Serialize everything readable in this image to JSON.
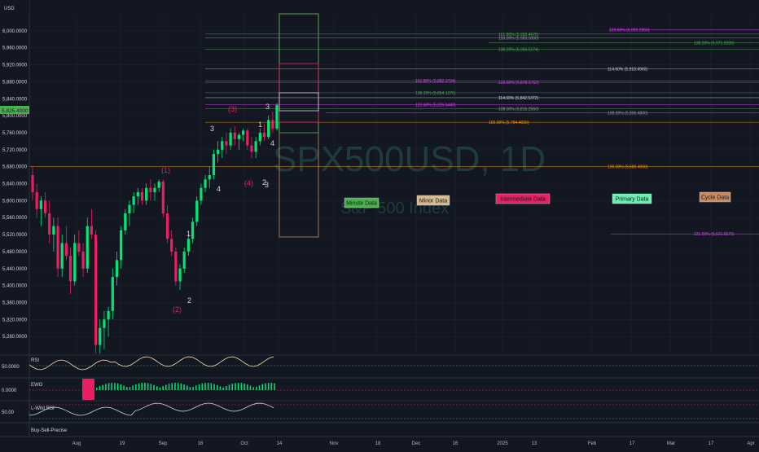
{
  "header": {
    "currency": "USD",
    "current_price": "5,825.4000"
  },
  "watermark": {
    "symbol": "SPX500USD, 1D",
    "name": "S&P 500 Index"
  },
  "price_axis": {
    "min": 5240,
    "max": 6040,
    "labels": [
      "6,000.0000",
      "5,960.0000",
      "5,920.0000",
      "5,880.0000",
      "5,840.0000",
      "5,800.0000",
      "5,760.0000",
      "5,720.0000",
      "5,680.0000",
      "5,640.0000",
      "5,600.0000",
      "5,560.0000",
      "5,520.0000",
      "5,480.0000",
      "5,440.0000",
      "5,400.0000",
      "5,360.0000",
      "5,320.0000",
      "5,280.0000"
    ],
    "values": [
      6000,
      5960,
      5920,
      5880,
      5840,
      5800,
      5760,
      5720,
      5680,
      5640,
      5600,
      5560,
      5520,
      5480,
      5440,
      5400,
      5360,
      5320,
      5280
    ]
  },
  "time_axis": {
    "labels": [
      "Aug",
      "19",
      "Sep",
      "16",
      "Oct",
      "14",
      "Nov",
      "18",
      "Dec",
      "16",
      "2025",
      "13",
      "Feb",
      "17",
      "Mar",
      "17",
      "Apr"
    ]
  },
  "chart_data": {
    "type": "candlestick",
    "title": "SPX500USD, 1D",
    "ylim": [
      5240,
      6040
    ],
    "bars": [
      [
        5660,
        5680,
        5600,
        5620
      ],
      [
        5620,
        5640,
        5560,
        5580
      ],
      [
        5580,
        5610,
        5540,
        5600
      ],
      [
        5600,
        5620,
        5560,
        5570
      ],
      [
        5570,
        5600,
        5500,
        5520
      ],
      [
        5520,
        5560,
        5480,
        5540
      ],
      [
        5540,
        5560,
        5420,
        5440
      ],
      [
        5440,
        5520,
        5420,
        5500
      ],
      [
        5500,
        5540,
        5460,
        5470
      ],
      [
        5470,
        5490,
        5380,
        5410
      ],
      [
        5410,
        5520,
        5400,
        5500
      ],
      [
        5500,
        5530,
        5470,
        5480
      ],
      [
        5480,
        5500,
        5420,
        5440
      ],
      [
        5440,
        5560,
        5430,
        5540
      ],
      [
        5540,
        5580,
        5510,
        5520
      ],
      [
        5520,
        5530,
        5240,
        5260
      ],
      [
        5260,
        5320,
        5200,
        5300
      ],
      [
        5300,
        5340,
        5250,
        5320
      ],
      [
        5320,
        5350,
        5280,
        5340
      ],
      [
        5340,
        5440,
        5320,
        5420
      ],
      [
        5420,
        5480,
        5400,
        5460
      ],
      [
        5460,
        5540,
        5440,
        5530
      ],
      [
        5530,
        5580,
        5520,
        5570
      ],
      [
        5570,
        5600,
        5540,
        5590
      ],
      [
        5590,
        5620,
        5570,
        5610
      ],
      [
        5610,
        5630,
        5590,
        5620
      ],
      [
        5620,
        5630,
        5590,
        5600
      ],
      [
        5600,
        5640,
        5590,
        5630
      ],
      [
        5630,
        5650,
        5600,
        5620
      ],
      [
        5620,
        5640,
        5600,
        5630
      ],
      [
        5630,
        5650,
        5620,
        5645
      ],
      [
        5645,
        5650,
        5560,
        5570
      ],
      [
        5570,
        5590,
        5500,
        5510
      ],
      [
        5510,
        5530,
        5470,
        5480
      ],
      [
        5480,
        5490,
        5400,
        5410
      ],
      [
        5410,
        5450,
        5390,
        5440
      ],
      [
        5440,
        5490,
        5430,
        5480
      ],
      [
        5480,
        5520,
        5470,
        5510
      ],
      [
        5510,
        5560,
        5500,
        5550
      ],
      [
        5550,
        5610,
        5540,
        5600
      ],
      [
        5600,
        5640,
        5590,
        5630
      ],
      [
        5630,
        5660,
        5620,
        5650
      ],
      [
        5650,
        5680,
        5630,
        5660
      ],
      [
        5660,
        5720,
        5650,
        5710
      ],
      [
        5710,
        5740,
        5690,
        5720
      ],
      [
        5720,
        5750,
        5700,
        5740
      ],
      [
        5740,
        5760,
        5710,
        5730
      ],
      [
        5730,
        5770,
        5720,
        5760
      ],
      [
        5760,
        5775,
        5730,
        5745
      ],
      [
        5745,
        5760,
        5720,
        5755
      ],
      [
        5755,
        5770,
        5740,
        5765
      ],
      [
        5765,
        5770,
        5720,
        5730
      ],
      [
        5730,
        5750,
        5700,
        5715
      ],
      [
        5715,
        5750,
        5700,
        5740
      ],
      [
        5740,
        5770,
        5730,
        5760
      ],
      [
        5760,
        5780,
        5740,
        5750
      ],
      [
        5750,
        5800,
        5745,
        5790
      ],
      [
        5790,
        5810,
        5760,
        5770
      ],
      [
        5770,
        5830,
        5765,
        5825
      ]
    ],
    "fib_levels": [
      {
        "label": "123.60% (6,002.2360)",
        "value": 6002.236,
        "color": "#e040fb"
      },
      {
        "label": "161.80% (5,992.4676)",
        "value": 5992.4676,
        "color": "#4caf50"
      },
      {
        "label": "150.00% (5,983.5000)",
        "value": 5983.5,
        "color": "#9598a1"
      },
      {
        "label": "138.20% (5,971.9289)",
        "value": 5971.9289,
        "color": "#4caf50"
      },
      {
        "label": "138.20% (5,956.5174)",
        "value": 5956.5174,
        "color": "#4caf50"
      },
      {
        "label": "114.60% (5,910.4960)",
        "value": 5910.496,
        "color": "#d1d4dc"
      },
      {
        "label": "161.80% (5,882.3724)",
        "value": 5882.3724,
        "color": "#e040fb"
      },
      {
        "label": "123.60% (5,878.3752)",
        "value": 5878.3752,
        "color": "#e040fb"
      },
      {
        "label": "138.20% (5,854.1276)",
        "value": 5854.1276,
        "color": "#4caf50"
      },
      {
        "label": "114.60% (5,842.5372)",
        "value": 5842.5372,
        "color": "#d1d4dc"
      },
      {
        "label": "123.60% (5,826.5440)",
        "value": 5826.544,
        "color": "#e040fb"
      },
      {
        "label": "108.00% (5,816.2560)",
        "value": 5816.256,
        "color": "#9598a1"
      },
      {
        "label": "108.00% (5,806.4800)",
        "value": 5806.48,
        "color": "#9598a1"
      },
      {
        "label": "100.00% (5,784.4000)",
        "value": 5784.4,
        "color": "#ff9800"
      },
      {
        "label": "100.00% (5,680.4000)",
        "value": 5680.4,
        "color": "#ff9800"
      },
      {
        "label": "131.50% (5,521.6670)",
        "value": 5521.667,
        "color": "#e040fb"
      }
    ]
  },
  "wave_labels": [
    {
      "text": "(1)",
      "color": "#e91e63"
    },
    {
      "text": "(2)",
      "color": "#e91e63"
    },
    {
      "text": "(3)",
      "color": "#e91e63"
    },
    {
      "text": "(4)",
      "color": "#e91e63"
    },
    {
      "text": "1",
      "color": "#d1d4dc"
    },
    {
      "text": "2",
      "color": "#d1d4dc"
    },
    {
      "text": "3",
      "color": "#d1d4dc"
    },
    {
      "text": "4",
      "color": "#d1d4dc"
    },
    {
      "text": "1",
      "color": "#d1d4dc"
    },
    {
      "text": "2",
      "color": "#d1d4dc"
    },
    {
      "text": "3",
      "color": "#d1d4dc"
    },
    {
      "text": "4",
      "color": "#d1d4dc"
    },
    {
      "text": "3",
      "color": "#d1d4dc"
    }
  ],
  "data_boxes": [
    {
      "label": "Minute Data",
      "bg": "#4caf50",
      "fg": "#131722"
    },
    {
      "label": "Minor Data",
      "bg": "#d7b98e",
      "fg": "#131722"
    },
    {
      "label": "Intermediate Data",
      "bg": "#e91e63",
      "fg": "#131722"
    },
    {
      "label": "Primary Data",
      "bg": "#69f0ae",
      "fg": "#131722"
    },
    {
      "label": "Cycle Data",
      "bg": "#c98b5e",
      "fg": "#131722"
    }
  ],
  "indicators": {
    "rsi": {
      "label": "RSI",
      "value": "50.0000"
    },
    "ewo": {
      "label": "EWO",
      "value": "0.0000"
    },
    "rsi2": {
      "label": "L-Wild RSI",
      "value": "50.00"
    },
    "buysell": {
      "label": "Buy-Sell-Precise"
    }
  },
  "colors": {
    "up": "#00e676",
    "down": "#e91e63",
    "background": "#131722",
    "grid": "#2a2e39"
  }
}
